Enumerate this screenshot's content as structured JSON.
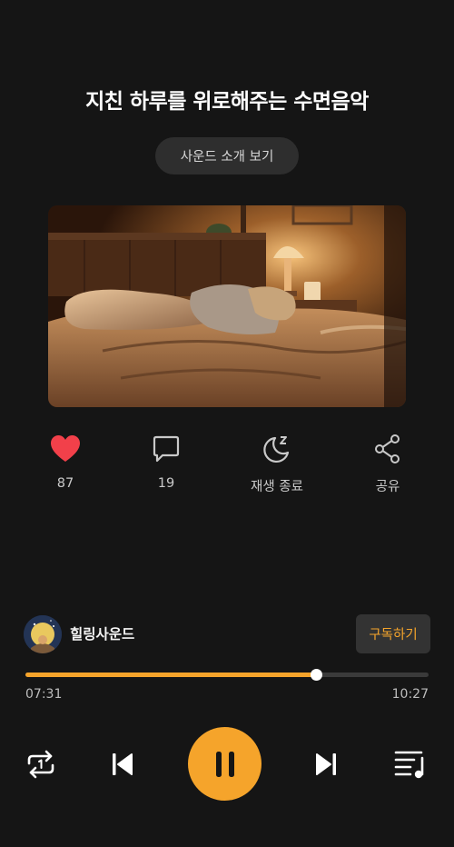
{
  "player": {
    "title": "지친 하루를 위로해주는 수면음악",
    "intro_button": "사운드 소개 보기"
  },
  "actions": {
    "like_count": "87",
    "comment_count": "19",
    "sleep_timer_label": "재생 종료",
    "share_label": "공유"
  },
  "channel": {
    "name": "힐링사운드",
    "subscribe_label": "구독하기"
  },
  "playback": {
    "current_time": "07:31",
    "total_time": "10:27",
    "progress_fraction": 0.72
  },
  "icons": [
    "heart-icon",
    "comment-icon",
    "moon-sleep-icon",
    "share-icon",
    "repeat-one-icon",
    "previous-icon",
    "pause-icon",
    "next-icon",
    "playlist-icon"
  ],
  "colors": {
    "accent": "#f5a42b",
    "like": "#f2404a",
    "background": "#151515"
  }
}
